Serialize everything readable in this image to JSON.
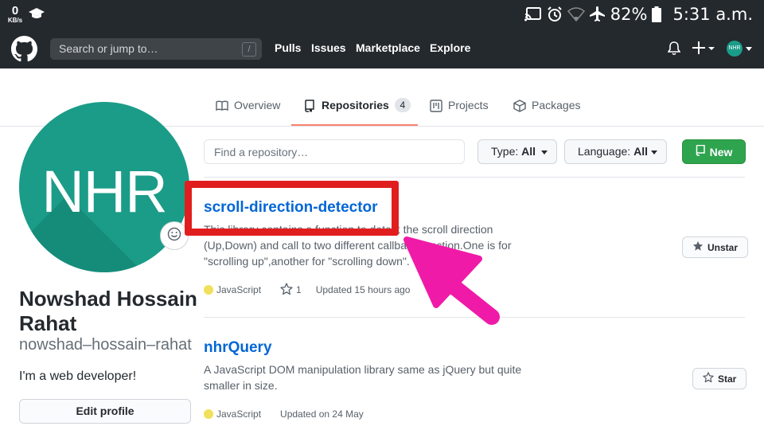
{
  "status_bar": {
    "net_speed_value": "0",
    "net_speed_unit": "KB/s",
    "battery": "82%",
    "time": "5:31 a.m."
  },
  "header": {
    "search_placeholder": "Search or jump to…",
    "search_shortcut": "/",
    "nav": [
      "Pulls",
      "Issues",
      "Marketplace",
      "Explore"
    ],
    "avatar_initials": "NHR"
  },
  "tabs": [
    {
      "label": "Overview",
      "icon": "book-icon"
    },
    {
      "label": "Repositories",
      "icon": "repo-icon",
      "count": "4",
      "active": true
    },
    {
      "label": "Projects",
      "icon": "project-icon"
    },
    {
      "label": "Packages",
      "icon": "package-icon"
    }
  ],
  "profile": {
    "avatar_initials": "NHR",
    "full_name": "Nowshad Hossain Rahat",
    "username": "nowshad–hossain–rahat",
    "bio": "I'm a web developer!",
    "edit_label": "Edit profile"
  },
  "filters": {
    "find_placeholder": "Find a repository…",
    "type_label": "Type:",
    "type_value": "All",
    "language_label": "Language:",
    "language_value": "All",
    "new_label": "New"
  },
  "repos": [
    {
      "name": "scroll-direction-detector",
      "description": "This library contains a function to detect the scroll direction (Up,Down) and call to two different callback function.One is for \"scrolling up\",another for \"scrolling down\".",
      "language": "JavaScript",
      "language_color": "#f1e05a",
      "stars": "1",
      "updated": "Updated 15 hours ago",
      "star_button": "Unstar"
    },
    {
      "name": "nhrQuery",
      "description": "A JavaScript DOM manipulation library same as jQuery but quite smaller in size.",
      "language": "JavaScript",
      "language_color": "#f1e05a",
      "updated": "Updated on 24 May",
      "star_button": "Star"
    }
  ],
  "colors": {
    "header_bg": "#24292e",
    "link_blue": "#0366d6",
    "new_green": "#2ea44f",
    "tab_underline": "#f9826c",
    "annotation_red": "#e11e1e",
    "annotation_pink": "#f01aa8",
    "avatar_teal": "#1a9c88"
  }
}
